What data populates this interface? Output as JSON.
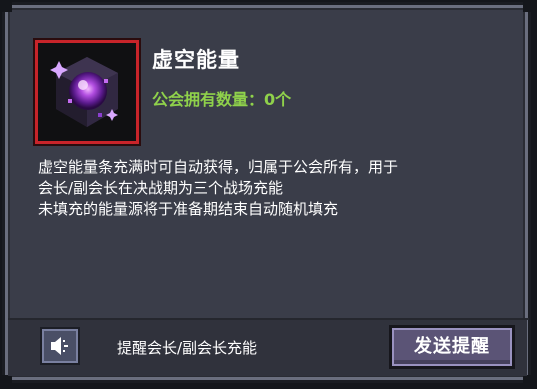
{
  "item": {
    "title": "虚空能量",
    "count_text": "公会拥有数量：0个",
    "icon": "void-energy-crystal-icon",
    "frame_color": "#c8242a"
  },
  "description": {
    "lines": [
      "虚空能量条充满时可自动获得，归属于公会所有，用于",
      "会长/副会长在决战期为三个战场充能",
      "未填充的能量源将于准备期结束自动随机填充"
    ]
  },
  "footer": {
    "speaker_icon": "speaker-icon",
    "remind_label": "提醒会长/副会长充能",
    "send_button_label": "发送提醒"
  },
  "colors": {
    "panel": "#3a3d49",
    "accent_green": "#8fd14b",
    "button": "#5b5476"
  }
}
